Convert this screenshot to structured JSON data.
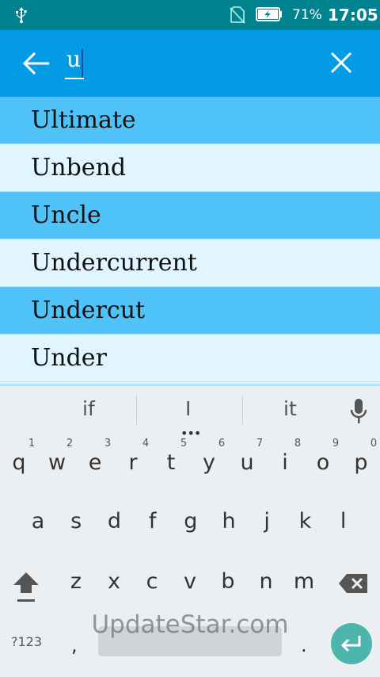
{
  "status_bar": {
    "battery_percent": "71%",
    "time": "17:05"
  },
  "search": {
    "query": "u"
  },
  "suggestions": [
    "Ultimate",
    "Unbend",
    "Uncle",
    "Undercurrent",
    "Undercut",
    "Under"
  ],
  "keyboard": {
    "word_suggestions": [
      "if",
      "I",
      "it"
    ],
    "row1": [
      "q",
      "w",
      "e",
      "r",
      "t",
      "y",
      "u",
      "i",
      "o",
      "p"
    ],
    "row1_hints": [
      "1",
      "2",
      "3",
      "4",
      "5",
      "6",
      "7",
      "8",
      "9",
      "0"
    ],
    "row2": [
      "a",
      "s",
      "d",
      "f",
      "g",
      "h",
      "j",
      "k",
      "l"
    ],
    "row3": [
      "z",
      "x",
      "c",
      "v",
      "b",
      "n",
      "m"
    ],
    "symbols_label": "?123",
    "comma": ",",
    "period": "."
  },
  "watermark": "UpdateStar.com",
  "colors": {
    "status_bar": "#00838F",
    "toolbar": "#039BE5",
    "row_dark": "#4FC3F7",
    "row_light": "#E1F5FE",
    "enter": "#4DB6AC"
  }
}
